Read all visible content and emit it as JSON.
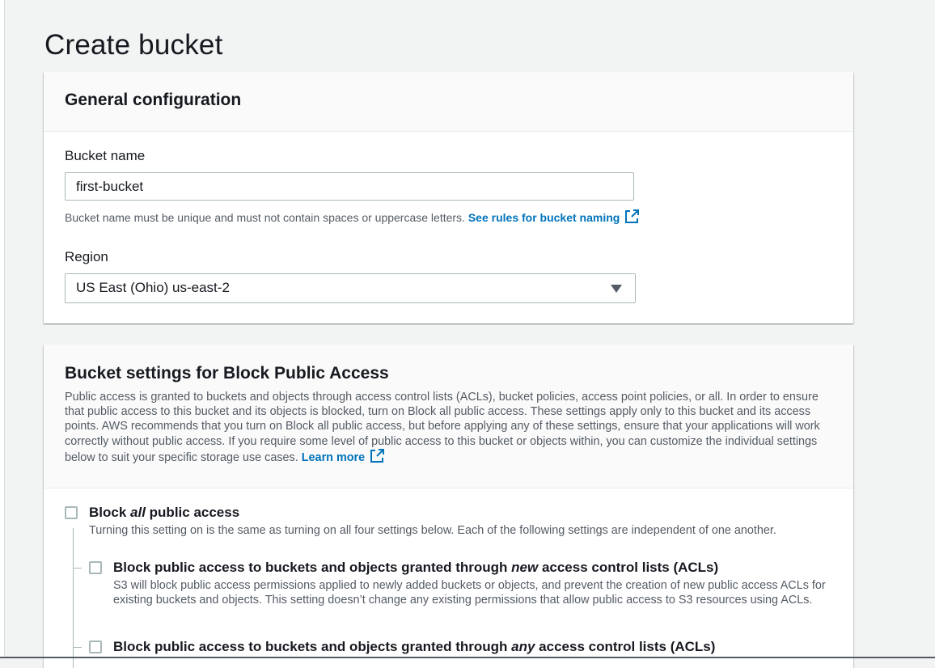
{
  "page": {
    "title": "Create bucket"
  },
  "general": {
    "title": "General configuration",
    "bucket_name_label": "Bucket name",
    "bucket_name_value": "first-bucket",
    "bucket_name_hint": "Bucket name must be unique and must not contain spaces or uppercase letters.",
    "naming_link": "See rules for bucket naming",
    "region_label": "Region",
    "region_value": "US East (Ohio) us-east-2"
  },
  "block_access": {
    "title": "Bucket settings for Block Public Access",
    "description": "Public access is granted to buckets and objects through access control lists (ACLs), bucket policies, access point policies, or all. In order to ensure that public access to this bucket and its objects is blocked, turn on Block all public access. These settings apply only to this bucket and its access points. AWS recommends that you turn on Block all public access, but before applying any of these settings, ensure that your applications will work correctly without public access. If you require some level of public access to this bucket or objects within, you can customize the individual settings below to suit your specific storage use cases.",
    "learn_more": "Learn more",
    "block_all": {
      "title_prefix": "Block ",
      "title_emphasis": "all",
      "title_suffix": " public access",
      "description": "Turning this setting on is the same as turning on all four settings below. Each of the following settings are independent of one another.",
      "checked": false
    },
    "options": [
      {
        "title_prefix": "Block public access to buckets and objects granted through ",
        "title_emphasis": "new",
        "title_suffix": " access control lists (ACLs)",
        "description": "S3 will block public access permissions applied to newly added buckets or objects, and prevent the creation of new public access ACLs for existing buckets and objects. This setting doesn’t change any existing permissions that allow public access to S3 resources using ACLs.",
        "checked": false
      },
      {
        "title_prefix": "Block public access to buckets and objects granted through ",
        "title_emphasis": "any",
        "title_suffix": " access control lists (ACLs)",
        "checked": false
      }
    ]
  }
}
